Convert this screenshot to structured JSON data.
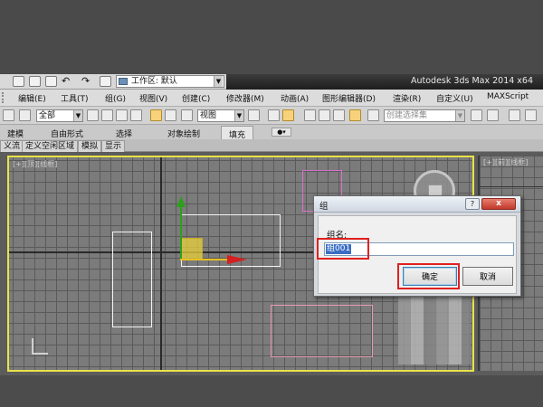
{
  "window": {
    "workspace_label": "工作区: 默认",
    "app_title": "Autodesk 3ds Max  2014 x64"
  },
  "menu": [
    {
      "label": "编辑(E)"
    },
    {
      "label": "工具(T)"
    },
    {
      "label": "组(G)"
    },
    {
      "label": "视图(V)"
    },
    {
      "label": "创建(C)"
    },
    {
      "label": "修改器(M)"
    },
    {
      "label": "动画(A)"
    },
    {
      "label": "图形编辑器(D)"
    },
    {
      "label": "渲染(R)"
    },
    {
      "label": "自定义(U)"
    },
    {
      "label": "MAXScript"
    }
  ],
  "toolbar": {
    "selection_filter": "全部",
    "reference_coord": "视图",
    "named_selection_placeholder": "创建选择集"
  },
  "ribbon_tabs": [
    {
      "label": "建模"
    },
    {
      "label": "自由形式"
    },
    {
      "label": "选择"
    },
    {
      "label": "对象绘制"
    },
    {
      "label": "填充"
    }
  ],
  "scene_tabs": [
    {
      "label": "义流"
    },
    {
      "label": "定义空闲区域"
    },
    {
      "label": "模拟"
    },
    {
      "label": "显示"
    }
  ],
  "viewport": {
    "label": "[+][顶][线框]",
    "right_label": "[+][前][线框]"
  },
  "dialog": {
    "title": "组",
    "help": "?",
    "close": "x",
    "name_label": "组名:",
    "name_value": "组001",
    "ok_label": "确定",
    "cancel_label": "取消"
  },
  "colors": {
    "viewport_border": "#e8e24a",
    "highlight_mark": "#e02020",
    "selection": "#3a6ec4"
  }
}
